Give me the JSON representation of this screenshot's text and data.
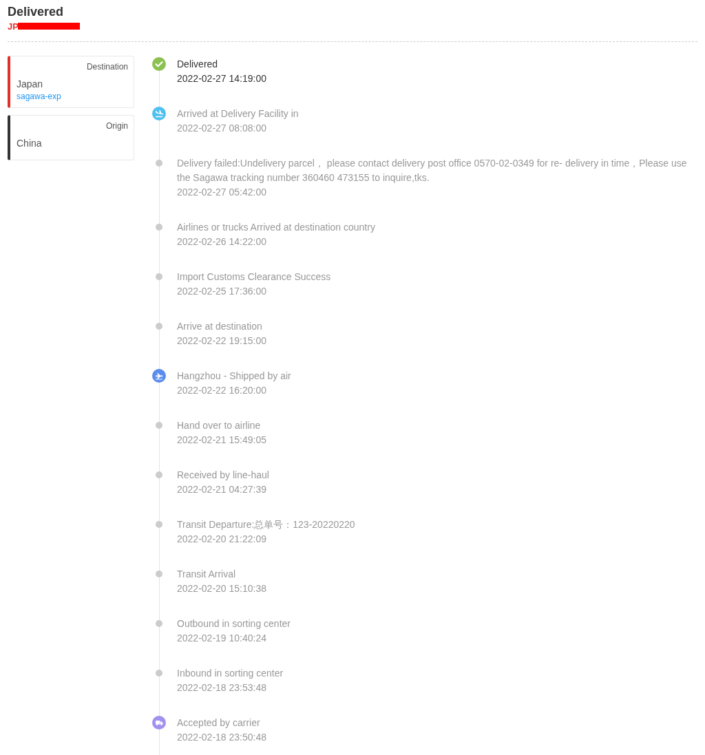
{
  "header": {
    "status": "Delivered",
    "tracking_number": "JP",
    "tracking_redacted": true
  },
  "places": [
    {
      "kind": "destination",
      "label": "Destination",
      "country": "Japan",
      "carrier": "sagawa-exp"
    },
    {
      "kind": "origin",
      "label": "Origin",
      "country": "China"
    }
  ],
  "events": [
    {
      "kind": "delivered",
      "current": true,
      "title": "Delivered",
      "time": "2022-02-27 14:19:00"
    },
    {
      "kind": "arrived",
      "current": false,
      "title": "Arrived at Delivery Facility in",
      "time": "2022-02-27 08:08:00"
    },
    {
      "kind": "step",
      "current": false,
      "title": "Delivery failed:Undelivery parcel， please contact delivery post office 0570-02-0349 for re- delivery in time，Please use the Sagawa tracking number 360460 473155 to inquire,tks.",
      "time": "2022-02-27 05:42:00"
    },
    {
      "kind": "step",
      "current": false,
      "title": "Airlines or trucks Arrived at destination country",
      "time": "2022-02-26 14:22:00"
    },
    {
      "kind": "step",
      "current": false,
      "title": "Import Customs Clearance Success",
      "time": "2022-02-25 17:36:00"
    },
    {
      "kind": "step",
      "current": false,
      "title": "Arrive at destination",
      "time": "2022-02-22 19:15:00"
    },
    {
      "kind": "shipped",
      "current": false,
      "title": "Hangzhou - Shipped by air",
      "time": "2022-02-22 16:20:00"
    },
    {
      "kind": "step",
      "current": false,
      "title": "Hand over to airline",
      "time": "2022-02-21 15:49:05"
    },
    {
      "kind": "step",
      "current": false,
      "title": "Received by line-haul",
      "time": "2022-02-21 04:27:39"
    },
    {
      "kind": "step",
      "current": false,
      "title": "Transit Departure:总单号：123-20220220",
      "time": "2022-02-20 21:22:09"
    },
    {
      "kind": "step",
      "current": false,
      "title": "Transit Arrival",
      "time": "2022-02-20 15:10:38"
    },
    {
      "kind": "step",
      "current": false,
      "title": "Outbound in sorting center",
      "time": "2022-02-19 10:40:24"
    },
    {
      "kind": "step",
      "current": false,
      "title": "Inbound in sorting center",
      "time": "2022-02-18 23:53:48"
    },
    {
      "kind": "accepted",
      "current": false,
      "title": "Accepted by carrier",
      "time": "2022-02-18 23:50:48"
    }
  ]
}
